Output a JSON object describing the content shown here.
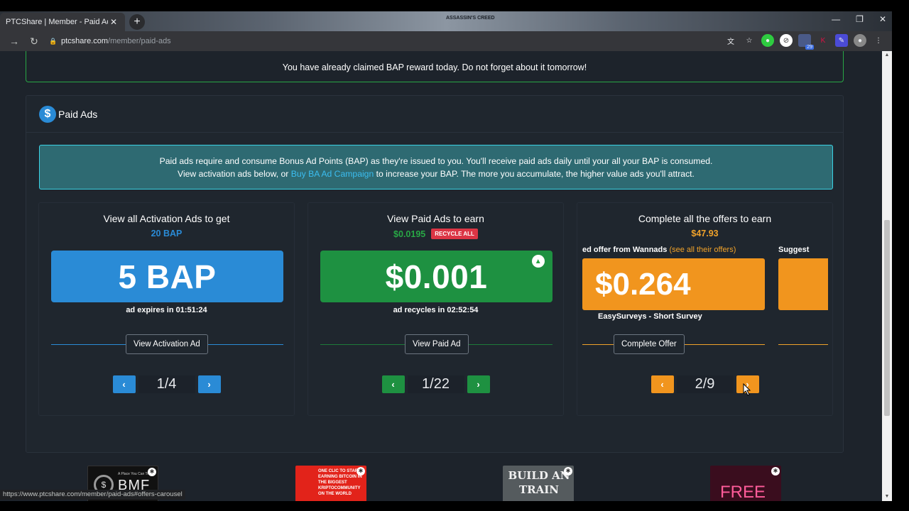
{
  "browser": {
    "tab_title": "PTCShare | Member - Paid Ads",
    "url_host": "ptcshare.com",
    "url_path": "/member/paid-ads",
    "status_url": "https://www.ptcshare.com/member/paid-ads#offers-carousel",
    "watermark_text": "ASSASSIN'S CREED",
    "extension_badge": "29"
  },
  "alert": {
    "text": "You have already claimed BAP reward today. Do not forget about it tomorrow!"
  },
  "panel": {
    "title": "Paid Ads",
    "info_line1": "Paid ads require and consume Bonus Ad Points (BAP) as they're issued to you. You'll receive paid ads daily until your all your BAP is consumed.",
    "info_line2_pre": "View activation ads below, or ",
    "info_link": "Buy BA Ad Campaign",
    "info_line2_post": " to increase your BAP. The more you accumulate, the higher value ads you'll attract."
  },
  "cards": {
    "activation": {
      "title": "View all Activation Ads to get",
      "subtitle": "20 BAP",
      "tile_value": "5 BAP",
      "caption_label": "ad expires in ",
      "caption_time": "01:51:24",
      "button": "View Activation Ad",
      "page": "1/4",
      "color": "#2a8bd6"
    },
    "paid": {
      "title": "View Paid Ads to earn",
      "subtitle": "$0.0195",
      "badge": "RECYCLE ALL",
      "tile_value": "$0.001",
      "caption_label": "ad recycles in ",
      "caption_time": "02:52:54",
      "button": "View Paid Ad",
      "page": "1/22",
      "color": "#1e9141"
    },
    "offers": {
      "title": "Complete all the offers to earn",
      "subtitle": "$47.93",
      "offer_label_pre": "ed offer from Wannads ",
      "offer_label_link": "(see all their offers)",
      "next_label": "Suggest",
      "tile_value": "$0.264",
      "offer_name": "EasySurveys - Short Survey",
      "button": "Complete Offer",
      "page": "2/9",
      "color": "#f1951e"
    }
  },
  "banners": [
    {
      "text": "BMF",
      "small": "A Place You Can Trust"
    },
    {
      "text": "ONE CLIC TO START EARNING BITCOIN IN THE BIGGEST KRIPTOCOMMUNITY ON THE WORLD"
    },
    {
      "text": "BUILD AN TRAIN"
    },
    {
      "text": "FREE"
    }
  ]
}
